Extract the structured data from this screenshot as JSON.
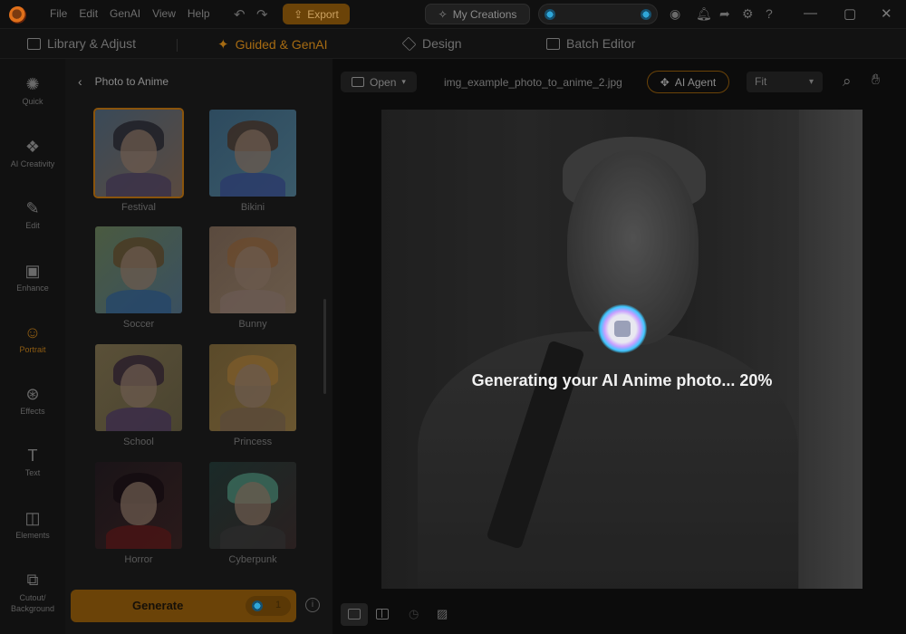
{
  "menu": [
    "File",
    "Edit",
    "GenAI",
    "View",
    "Help"
  ],
  "toolbar": {
    "export_label": "Export",
    "my_creations_label": "My Creations"
  },
  "mode_tabs": [
    {
      "label": "Library & Adjust",
      "icon": "library-icon"
    },
    {
      "label": "Guided & GenAI",
      "icon": "sparkle-icon",
      "active": true
    },
    {
      "label": "Design",
      "icon": "layers-icon"
    },
    {
      "label": "Batch Editor",
      "icon": "batch-icon"
    }
  ],
  "rail": [
    {
      "label": "Quick",
      "icon": "magic-wand-icon"
    },
    {
      "label": "AI Creativity",
      "icon": "ai-creativity-icon"
    },
    {
      "label": "Edit",
      "icon": "edit-icon"
    },
    {
      "label": "Enhance",
      "icon": "enhance-icon"
    },
    {
      "label": "Portrait",
      "icon": "portrait-icon",
      "active": true
    },
    {
      "label": "Effects",
      "icon": "effects-icon"
    },
    {
      "label": "Text",
      "icon": "text-icon"
    },
    {
      "label": "Elements",
      "icon": "elements-icon"
    },
    {
      "label": "Cutout/\nBackground",
      "icon": "cutout-icon"
    }
  ],
  "panel": {
    "title": "Photo to Anime",
    "styles": [
      {
        "label": "Festival",
        "selected": true
      },
      {
        "label": "Bikini"
      },
      {
        "label": "Soccer"
      },
      {
        "label": "Bunny"
      },
      {
        "label": "School"
      },
      {
        "label": "Princess"
      },
      {
        "label": "Horror"
      },
      {
        "label": "Cyberpunk"
      }
    ],
    "generate_label": "Generate",
    "generate_cost": "1"
  },
  "canvas": {
    "open_label": "Open",
    "filename": "img_example_photo_to_anime_2.jpg",
    "ai_agent_label": "AI Agent",
    "zoom_option": "Fit",
    "progress_text": "Generating your AI Anime photo... 20%",
    "progress_percent": 20
  },
  "colors": {
    "accent": "#8d5b12",
    "background": "#0e0e0e"
  }
}
